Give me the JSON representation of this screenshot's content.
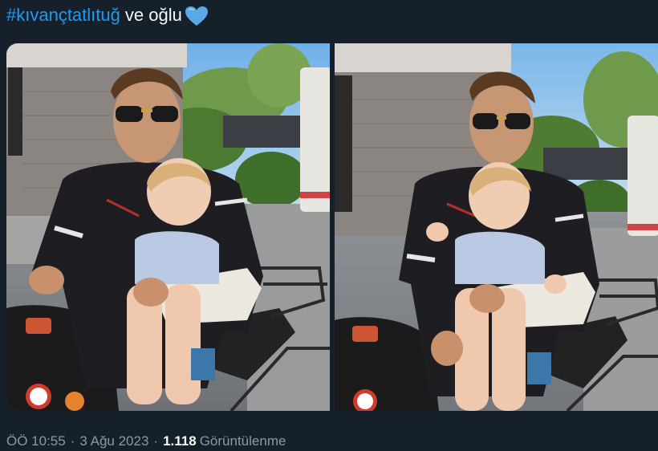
{
  "tweet": {
    "hashtag": "#kıvançtatlıtuğ",
    "text": "ve oğlu",
    "emoji_icon": "blue-heart-icon"
  },
  "media": {
    "photos": [
      {
        "alt": "photo-1",
        "icon": "photo"
      },
      {
        "alt": "photo-2",
        "icon": "photo"
      }
    ]
  },
  "meta": {
    "time": "ÖÖ 10:55",
    "separator": "·",
    "date": "3 Ağu 2023",
    "views_count": "1.118",
    "views_label": "Görüntülenme"
  },
  "colors": {
    "background": "#15202b",
    "hashtag": "#1d9bf0",
    "text": "#f7f9f9",
    "secondary": "#8b98a5",
    "heart": "#5aa9e6"
  }
}
